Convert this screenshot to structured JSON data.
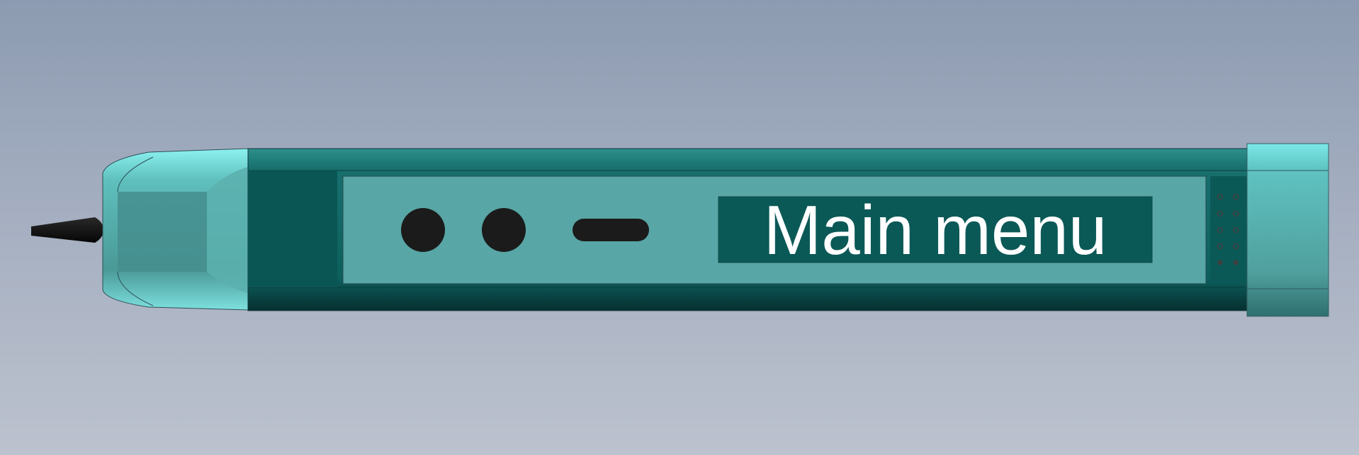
{
  "screen": {
    "text": "Main menu"
  },
  "colors": {
    "background_top": "#8c9bb1",
    "background_bottom": "#bcc2ce",
    "body_dark": "#0b5f5e",
    "body_mid": "#1c7b79",
    "panel": "#58a6a5",
    "cap_light": "#7ee8e8",
    "screen_background": "#0b5957",
    "screen_text": "#ffffff",
    "button": "#1b1b1b"
  },
  "icons": [
    "probe-tip-icon",
    "round-button-icon",
    "pill-button-icon",
    "speaker-grille-icon"
  ]
}
